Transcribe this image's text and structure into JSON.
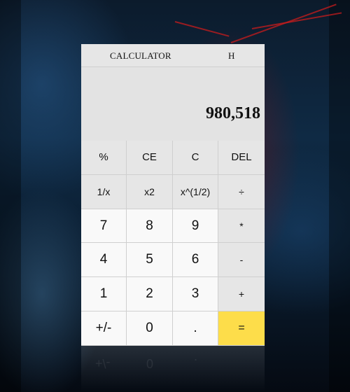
{
  "app": {
    "title": "CALCULATOR",
    "menu_label": "H"
  },
  "display": {
    "value": "980,518"
  },
  "keys": {
    "percent": "%",
    "clear_entry": "CE",
    "clear": "C",
    "delete": "DEL",
    "reciprocal": "1/x",
    "square": "x2",
    "square_root": "x^(1/2)",
    "divide": "÷",
    "seven": "7",
    "eight": "8",
    "nine": "9",
    "multiply": "*",
    "four": "4",
    "five": "5",
    "six": "6",
    "subtract": "-",
    "one": "1",
    "two": "2",
    "three": "3",
    "add": "+",
    "negate": "+/-",
    "zero": "0",
    "decimal": ".",
    "equals": "="
  },
  "colors": {
    "equals_key": "#fddd4a",
    "number_key": "#f9f9f9",
    "function_key": "#e6e6e6"
  }
}
